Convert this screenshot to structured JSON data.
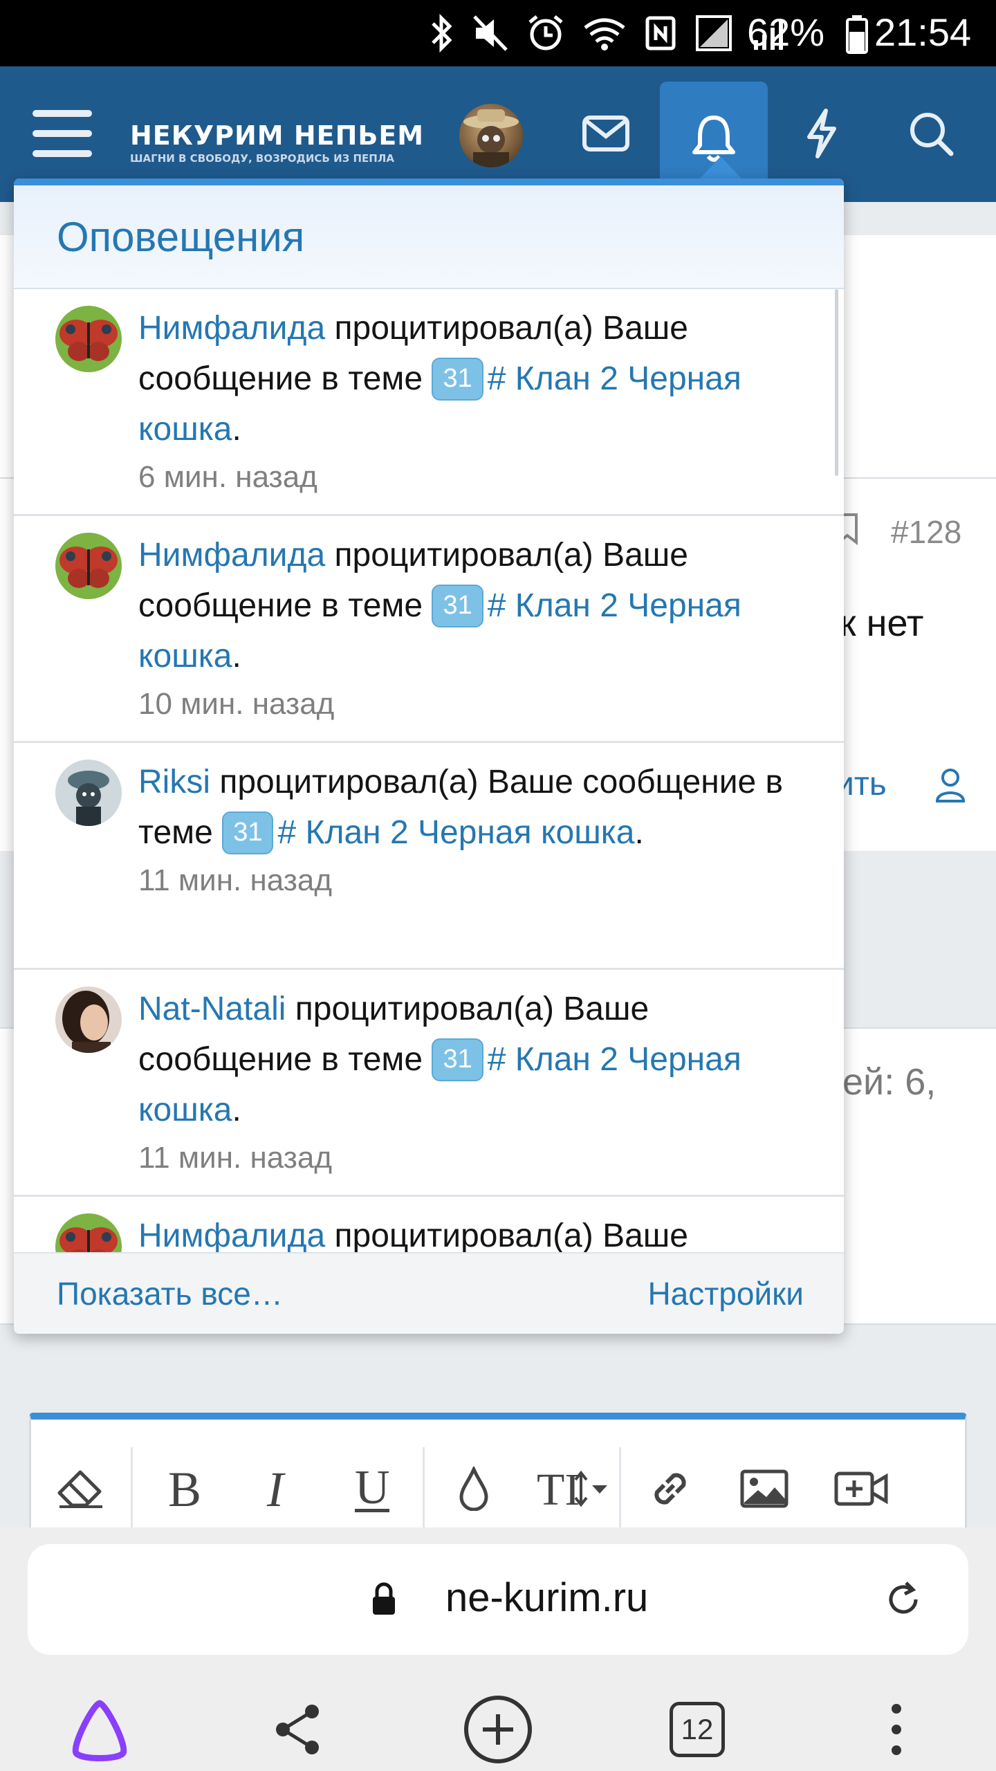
{
  "status_bar": {
    "battery": "62%",
    "time": "21:54"
  },
  "header": {
    "logo_title": "НЕКУРИМ НЕПЬЕМ",
    "logo_subtitle": "ШАГНИ В СВОБОДУ, ВОЗРОДИСЬ ИЗ ПЕПЛА"
  },
  "background": {
    "post_number": "#128",
    "text_fragment_1": "к нет",
    "text_fragment_2": "ить",
    "text_fragment_3": "ей: 6,"
  },
  "notifications": {
    "title": "Оповещения",
    "items": [
      {
        "user": "Нимфалида",
        "action": "процитировал(а) Ваше сообщение в теме",
        "badge": "31",
        "thread": "# Клан 2 Черная кошка",
        "time": "6 мин. назад"
      },
      {
        "user": "Нимфалида",
        "action": "процитировал(а) Ваше сообщение в теме",
        "badge": "31",
        "thread": "# Клан 2 Черная кошка",
        "time": "10 мин. назад"
      },
      {
        "user": "Riksi",
        "action": "процитировал(а) Ваше сообщение в теме",
        "badge": "31",
        "thread": "# Клан 2 Черная кошка",
        "time": "11 мин. назад"
      },
      {
        "user": "Nat-Natali",
        "action": "процитировал(а) Ваше сообщение в теме",
        "badge": "31",
        "thread": "# Клан 2 Черная кошка",
        "time": "11 мин. назад"
      },
      {
        "user": "Нимфалида",
        "action": "процитировал(а) Ваше",
        "badge": "",
        "thread": "",
        "time": ""
      }
    ],
    "show_all": "Показать все…",
    "settings": "Настройки"
  },
  "browser": {
    "url": "ne-kurim.ru",
    "tab_count": "12"
  },
  "colors": {
    "header": "#1f5a8c",
    "accent": "#3b8fd8",
    "link": "#2577b1",
    "badge": "#7dc2e6"
  }
}
